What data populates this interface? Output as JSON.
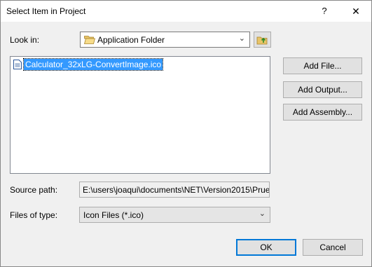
{
  "window": {
    "title": "Select Item in Project",
    "help_label": "?",
    "close_label": "✕"
  },
  "look_in": {
    "label": "Look in:",
    "value": "Application Folder"
  },
  "files": [
    {
      "name": "Calculator_32xLG-ConvertImage.ico"
    }
  ],
  "buttons": {
    "add_file": "Add File...",
    "add_output": "Add Output...",
    "add_assembly": "Add Assembly...",
    "ok": "OK",
    "cancel": "Cancel"
  },
  "source_path": {
    "label": "Source path:",
    "value": "E:\\users\\joaqui\\documents\\NET\\Version2015\\Prue"
  },
  "files_of_type": {
    "label": "Files of type:",
    "value": "Icon Files (*.ico)"
  },
  "colors": {
    "selection": "#3399ff",
    "accent": "#0078d7"
  }
}
